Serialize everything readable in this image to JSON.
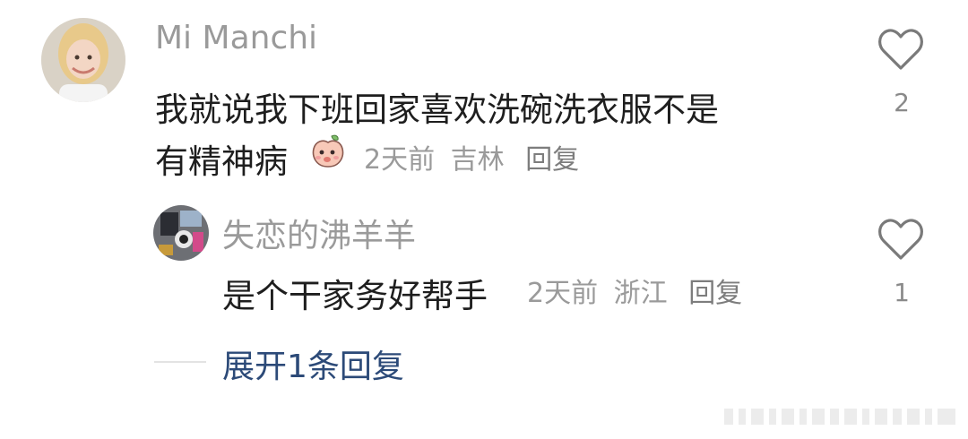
{
  "comment": {
    "username": "Mi Manchi",
    "text_line1": "我就说我下班回家喜欢洗碗洗衣服不是",
    "text_line2": "有精神病",
    "time": "2天前",
    "location": "吉林",
    "reply_label": "回复",
    "like_count": "2"
  },
  "reply": {
    "username": "失恋的沸羊羊",
    "text": "是个干家务好帮手",
    "time": "2天前",
    "location": "浙江",
    "reply_label": "回复",
    "like_count": "1"
  },
  "expand": {
    "label": "展开1条回复"
  },
  "colors": {
    "name": "#9a9a9a",
    "text": "#1e1e1e",
    "link": "#2c4a78"
  },
  "icons": {
    "like": "heart-outline-icon",
    "emoji": "peach-face-emoji"
  }
}
